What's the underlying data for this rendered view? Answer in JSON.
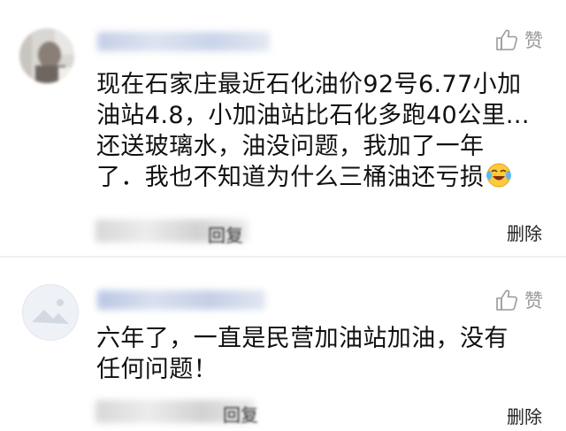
{
  "comments": [
    {
      "like_label": "赞",
      "lines": [
        "现在石家庄最近石化油价92号6.77小加",
        "油站4.8，小加油站比石化多跑40公里...",
        "还送玻璃水，油没问题，我加了一年",
        "了．我也不知道为什么三桶油还亏损"
      ],
      "emoji_icon": "laughing-crying-face-icon",
      "reply_label": "回复",
      "delete_label": "删除"
    },
    {
      "like_label": "赞",
      "lines": [
        "六年了，一直是民营加油站加油，没有",
        "任何问题！"
      ],
      "reply_label": "回复",
      "delete_label": "删除"
    }
  ],
  "colors": {
    "text": "#111111",
    "secondary": "#9a9a9a",
    "username_blur": "#c9d4ea",
    "divider": "#f0f0f0"
  }
}
